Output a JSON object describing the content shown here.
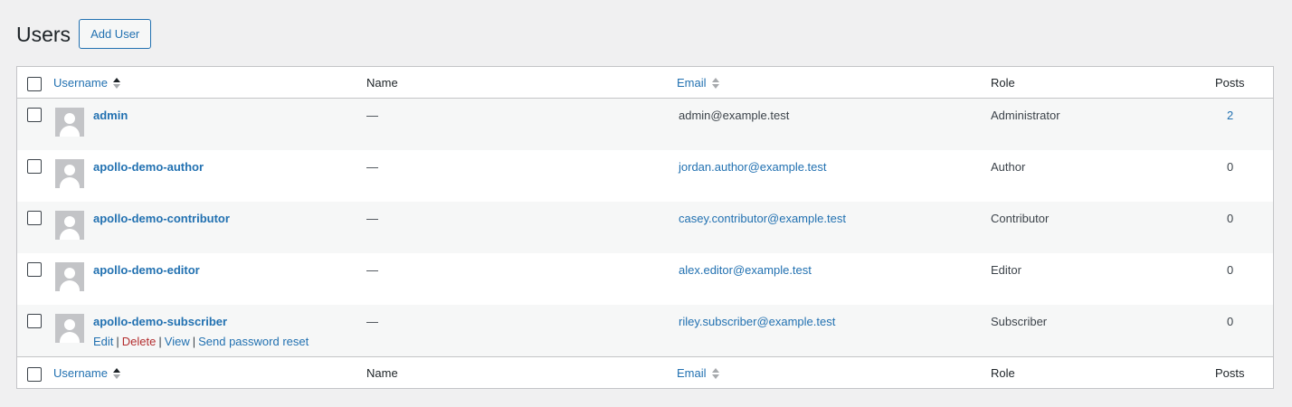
{
  "header": {
    "title": "Users",
    "add_button": "Add User"
  },
  "columns": {
    "username": "Username",
    "name": "Name",
    "email": "Email",
    "role": "Role",
    "posts": "Posts"
  },
  "users": [
    {
      "username": "admin",
      "name": "—",
      "email": "admin@example.test",
      "email_is_link": false,
      "role": "Administrator",
      "posts": "2",
      "posts_is_link": true
    },
    {
      "username": "apollo-demo-author",
      "name": "—",
      "email": "jordan.author@example.test",
      "email_is_link": true,
      "role": "Author",
      "posts": "0",
      "posts_is_link": false
    },
    {
      "username": "apollo-demo-contributor",
      "name": "—",
      "email": "casey.contributor@example.test",
      "email_is_link": true,
      "role": "Contributor",
      "posts": "0",
      "posts_is_link": false
    },
    {
      "username": "apollo-demo-editor",
      "name": "—",
      "email": "alex.editor@example.test",
      "email_is_link": true,
      "role": "Editor",
      "posts": "0",
      "posts_is_link": false
    },
    {
      "username": "apollo-demo-subscriber",
      "name": "—",
      "email": "riley.subscriber@example.test",
      "email_is_link": true,
      "role": "Subscriber",
      "posts": "0",
      "posts_is_link": false
    }
  ],
  "row_actions": {
    "edit": "Edit",
    "delete": "Delete",
    "view": "View",
    "reset": "Send password reset",
    "separator": "|"
  },
  "colors": {
    "link": "#2271b1",
    "delete": "#b32d2e",
    "alt_row": "#f6f7f7",
    "background": "#f0f0f1"
  }
}
